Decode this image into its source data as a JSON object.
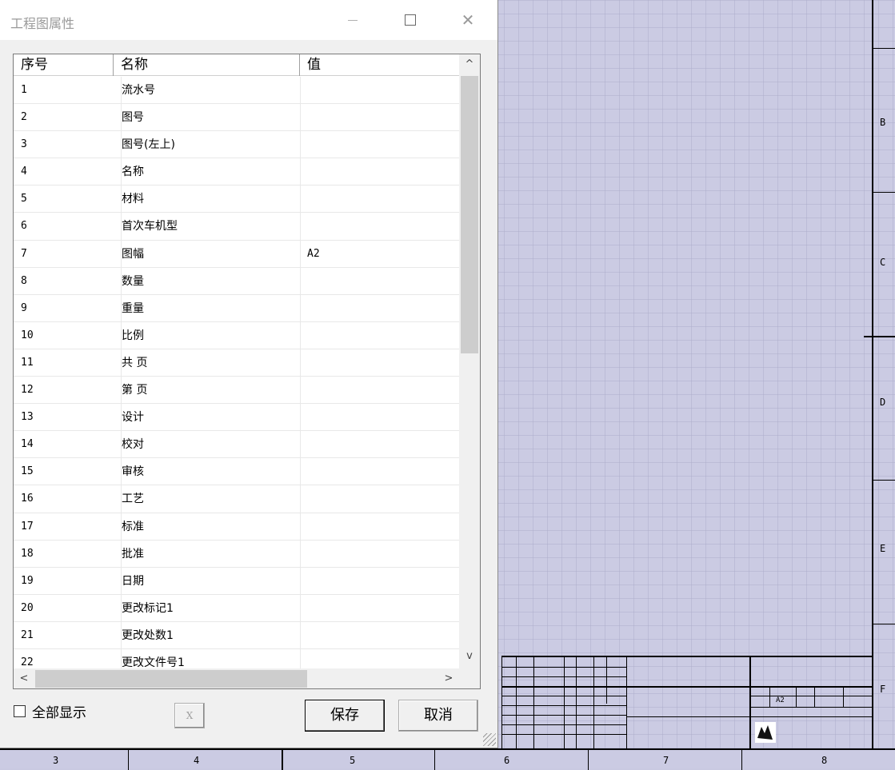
{
  "dialog": {
    "title": "工程图属性",
    "close_glyph": "✕",
    "columns": [
      "序号",
      "名称",
      "值"
    ],
    "rows": [
      {
        "no": "1",
        "name": "流水号",
        "value": ""
      },
      {
        "no": "2",
        "name": "图号",
        "value": ""
      },
      {
        "no": "3",
        "name": "图号(左上)",
        "value": ""
      },
      {
        "no": "4",
        "name": "名称",
        "value": ""
      },
      {
        "no": "5",
        "name": "材料",
        "value": ""
      },
      {
        "no": "6",
        "name": "首次车机型",
        "value": ""
      },
      {
        "no": "7",
        "name": "图幅",
        "value": "A2"
      },
      {
        "no": "8",
        "name": "数量",
        "value": ""
      },
      {
        "no": "9",
        "name": "重量",
        "value": ""
      },
      {
        "no": "10",
        "name": "比例",
        "value": ""
      },
      {
        "no": "11",
        "name": "共 页",
        "value": ""
      },
      {
        "no": "12",
        "name": "第 页",
        "value": ""
      },
      {
        "no": "13",
        "name": "设计",
        "value": ""
      },
      {
        "no": "14",
        "name": "校对",
        "value": ""
      },
      {
        "no": "15",
        "name": "审核",
        "value": ""
      },
      {
        "no": "16",
        "name": "工艺",
        "value": ""
      },
      {
        "no": "17",
        "name": "标准",
        "value": ""
      },
      {
        "no": "18",
        "name": "批准",
        "value": ""
      },
      {
        "no": "19",
        "name": "日期",
        "value": ""
      },
      {
        "no": "20",
        "name": "更改标记1",
        "value": ""
      },
      {
        "no": "21",
        "name": "更改处数1",
        "value": ""
      },
      {
        "no": "22",
        "name": "更改文件号1",
        "value": ""
      }
    ],
    "scroll_up": "^",
    "scroll_down": "v",
    "scroll_left": "<",
    "scroll_right": ">",
    "show_all_label": "全部显示",
    "show_all_checked": false,
    "x_button_label": "X",
    "save_label": "保存",
    "cancel_label": "取消"
  },
  "drawing": {
    "zone_letters": [
      "B",
      "C",
      "D",
      "E",
      "F"
    ],
    "zone_numbers": [
      "3",
      "4",
      "5",
      "6",
      "7",
      "8"
    ],
    "title_block": {
      "sheet_size": "A2"
    }
  }
}
